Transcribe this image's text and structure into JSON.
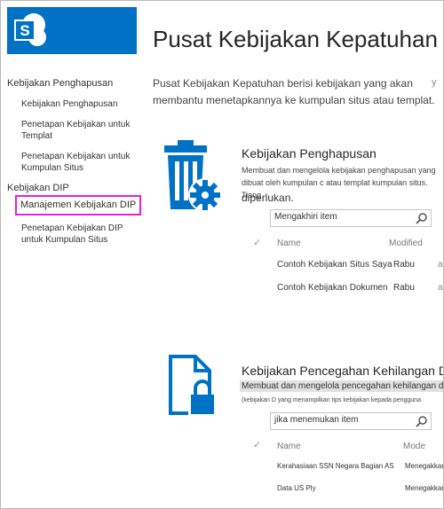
{
  "header": {
    "title": "Pusat Kebijakan Kepatuhan",
    "logo_letter": "S"
  },
  "intro": {
    "text": "Pusat Kebijakan Kepatuhan berisi kebijakan yang akan membantu menetapkannya ke kumpulan situs atau templat.",
    "clip": "y"
  },
  "nav": {
    "group1": "Kebijakan Penghapusan",
    "item1": "Kebijakan Penghapusan",
    "item2": "Penetapan Kebijakan untuk Templat",
    "item3": "Penetapan Kebijakan untuk Kumpulan Situs",
    "group2": "Kebijakan DIP",
    "item4": "Manajemen Kebijakan DIP",
    "item5": "Penetapan Kebijakan DIP untuk Kumpulan Situs"
  },
  "deletion": {
    "title": "Kebijakan Penghapusan",
    "desc": "Membuat dan mengelola kebijakan penghapusan yang dibuat oleh kumpulan c atau templat kumpulan situs. Tiang",
    "desc2": "diperlukan.",
    "search_placeholder": "Mengakhiri item",
    "col_name": "Name",
    "col_modified": "Modified",
    "rows": [
      {
        "name": "Contoh Kebijakan Situs Saya",
        "modified": "Rabu",
        "extra": "a"
      },
      {
        "name": "Contoh Kebijakan Dokumen",
        "modified": "Rabu",
        "extra": "a"
      }
    ]
  },
  "dlp": {
    "title": "Kebijakan Pencegahan Kehilangan Data",
    "desc_highlight": "Membuat dan mengelola pencegahan kehilangan data",
    "desc_small": "(kebijakan D yang menampilkan tips kebijakan kepada pengguna",
    "search_placeholder": "jika menemukan item",
    "col_name": "Name",
    "col_mode": "Mode",
    "rows": [
      {
        "name": "Kerahasiaan SSN Negara Bagian AS",
        "mode": "Menegakkan"
      },
      {
        "name": "Data US Ply",
        "mode": "Menegakkan"
      }
    ]
  },
  "colors": {
    "brand": "#0072c6",
    "selection_outline": "#e61ee6"
  }
}
